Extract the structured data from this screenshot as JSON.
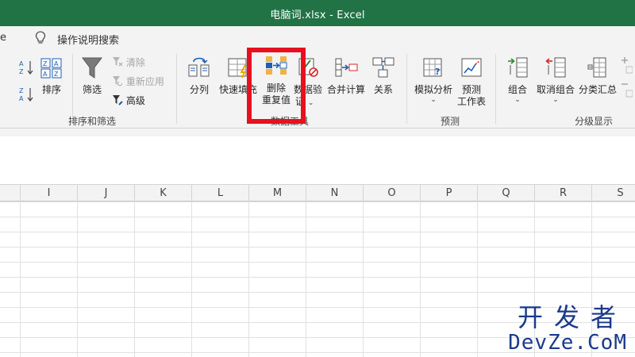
{
  "window": {
    "title": "电脑词.xlsx  -  Excel"
  },
  "tell_me": {
    "edge_label": "e",
    "text": "操作说明搜索"
  },
  "ribbon": {
    "sort_filter": {
      "sort_label": "排序",
      "filter_label": "筛选",
      "clear_label": "清除",
      "reapply_label": "重新应用",
      "advanced_label": "高级",
      "group_label": "排序和筛选"
    },
    "data_tools": {
      "split_label": "分列",
      "flash_fill_label": "快速填充",
      "remove_dup_line1": "删除",
      "remove_dup_line2": "重复值",
      "validation_line1": "数据验",
      "validation_line2": "证",
      "consolidate_label": "合并计算",
      "relations_label": "关系",
      "group_label": "数据工具"
    },
    "forecast": {
      "whatif_label": "模拟分析",
      "sheet_line1": "预测",
      "sheet_line2": "工作表",
      "group_label": "预测"
    },
    "outline": {
      "group_btn_label": "组合",
      "ungroup_label": "取消组合",
      "subtotal_label": "分类汇总",
      "group_label": "分级显示"
    },
    "colors": {
      "accent": "#217346",
      "highlight": "#e8101f"
    }
  },
  "columns": [
    "I",
    "J",
    "K",
    "L",
    "M",
    "N",
    "O",
    "P",
    "Q",
    "R",
    "S"
  ],
  "watermark": {
    "line1": "开发者",
    "line2": "DevZe.CoM"
  }
}
